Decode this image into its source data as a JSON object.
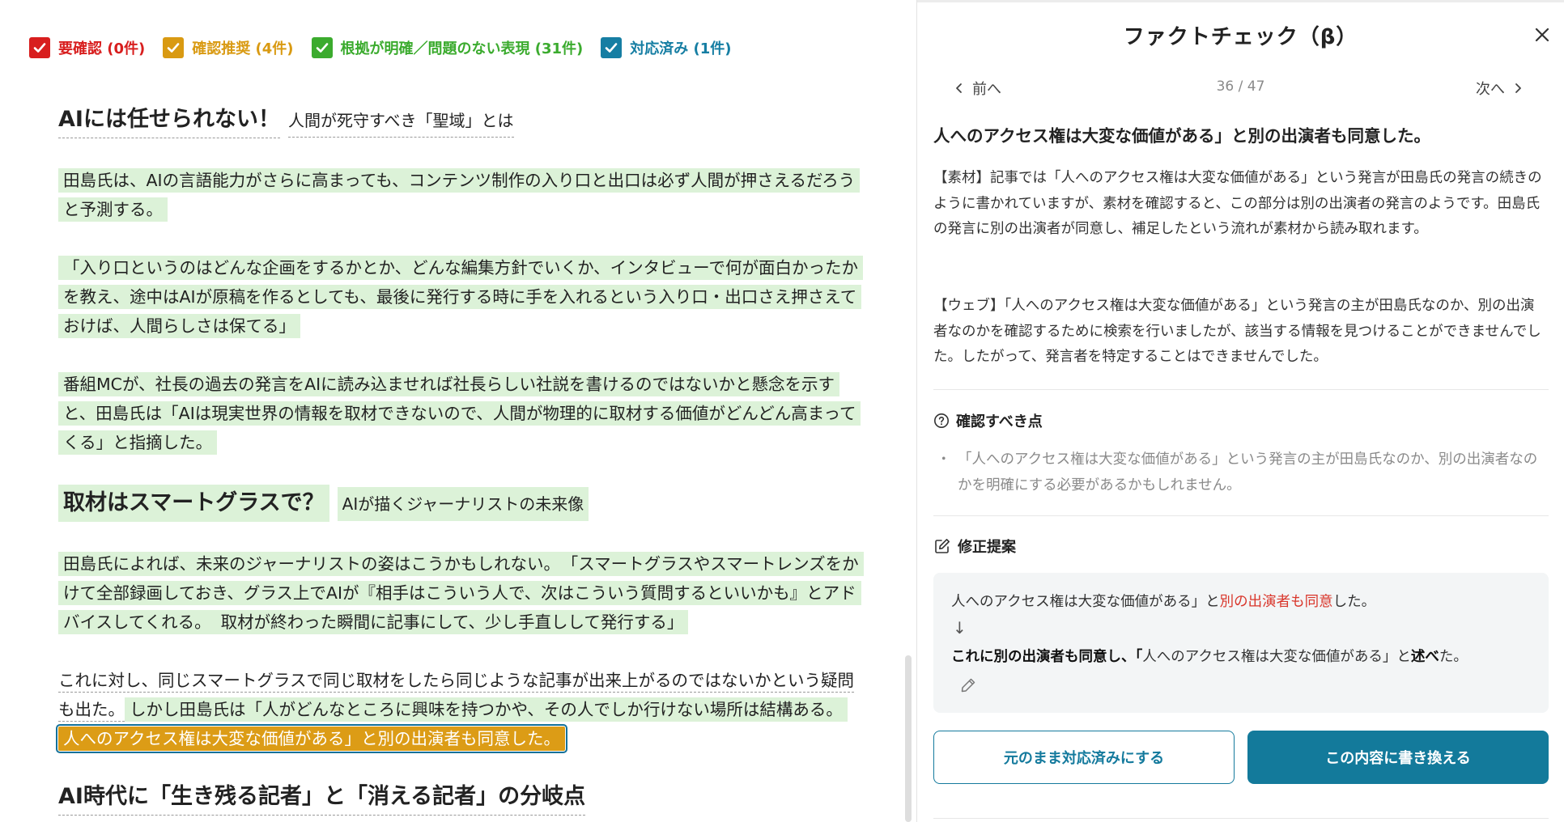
{
  "filters": [
    {
      "label": "要確認 (0件)",
      "color": "#d81e1e"
    },
    {
      "label": "確認推奨 (4件)",
      "color": "#d99a12"
    },
    {
      "label": "根拠が明確／問題のない表現 (31件)",
      "color": "#3bab2e"
    },
    {
      "label": "対応済み (1件)",
      "color": "#167ea3"
    }
  ],
  "doc": {
    "h1_main": "AIには任せられない！",
    "h1_sub": "人間が死守すべき「聖域」とは",
    "p1": "田島氏は、AIの言語能力がさらに高まっても、コンテンツ制作の入り口と出口は必ず人間が押さえるだろうと予測する。",
    "p2": "「入り口というのはどんな企画をするかとか、どんな編集方針でいくか、インタビューで何が面白かったかを教え、途中はAIが原稿を作るとしても、最後に発行する時に手を入れるという入り口・出口さえ押さえておけば、人間らしさは保てる」",
    "p3": "番組MCが、社長の過去の発言をAIに読み込ませれば社長らしい社説を書けるのではないかと懸念を示すと、田島氏は「AIは現実世界の情報を取材できないので、人間が物理的に取材する価値がどんどん高まってくる」と指摘した。",
    "h2_main": "取材はスマートグラスで？",
    "h2_sub": "AIが描くジャーナリストの未来像",
    "p4a": "田島氏によれば、未来のジャーナリストの姿はこうかもしれない。",
    "p4b": "「スマートグラスやスマートレンズをかけて全部録画しておき、グラス上でAIが『相手はこういう人で、次はこういう質問するといいかも』とアドバイスしてくれる。",
    "p4c": "取材が終わった瞬間に記事にして、少し手直しして発行する」",
    "p5a": "これに対し、同じスマートグラスで同じ取材をしたら同じような記事が出来上がるのではないかという疑問も出た。",
    "p5b": "しかし田島氏は「人がどんなところに興味を持つかや、その人でしか行けない場所は結構ある。",
    "p5c": "人へのアクセス権は大変な価値がある」と別の出演者も同意した。",
    "h3_main": "AI時代に「生き残る記者」と「消える記者」の分岐点"
  },
  "panel": {
    "title": "ファクトチェック（β）",
    "prev": "前へ",
    "next": "次へ",
    "count": "36 / 47",
    "claim": "人へのアクセス権は大変な価値がある」と別の出演者も同意した。",
    "material": "【素材】記事では「人へのアクセス権は大変な価値がある」という発言が田島氏の発言の続きのように書かれていますが、素材を確認すると、この部分は別の出演者の発言のようです。田島氏の発言に別の出演者が同意し、補足したという流れが素材から読み取れます。",
    "web": "【ウェブ】「人へのアクセス権は大変な価値がある」という発言の主が田島氏なのか、別の出演者なのかを確認するために検索を行いましたが、該当する情報を見つけることができませんでした。したがって、発言者を特定することはできませんでした。",
    "check_heading": "確認すべき点",
    "check_dot": "・",
    "check_item": "「人へのアクセス権は大変な価値がある」という発言の主が田島氏なのか、別の出演者なのかを明確にする必要があるかもしれません。",
    "suggest_heading": "修正提案",
    "before_plain": "人へのアクセス権は大変な価値がある」と",
    "before_red": "別の出演者も同意",
    "before_end": "した。",
    "arrow": "↓",
    "after_bold1": "これに別の出演者も同意し、「",
    "after_plain": "人へのアクセス権は大変な価値がある」と",
    "after_bold2": "述べ",
    "after_end": "た。",
    "btn_keep": "元のまま対応済みにする",
    "btn_rewrite": "この内容に書き換える"
  }
}
